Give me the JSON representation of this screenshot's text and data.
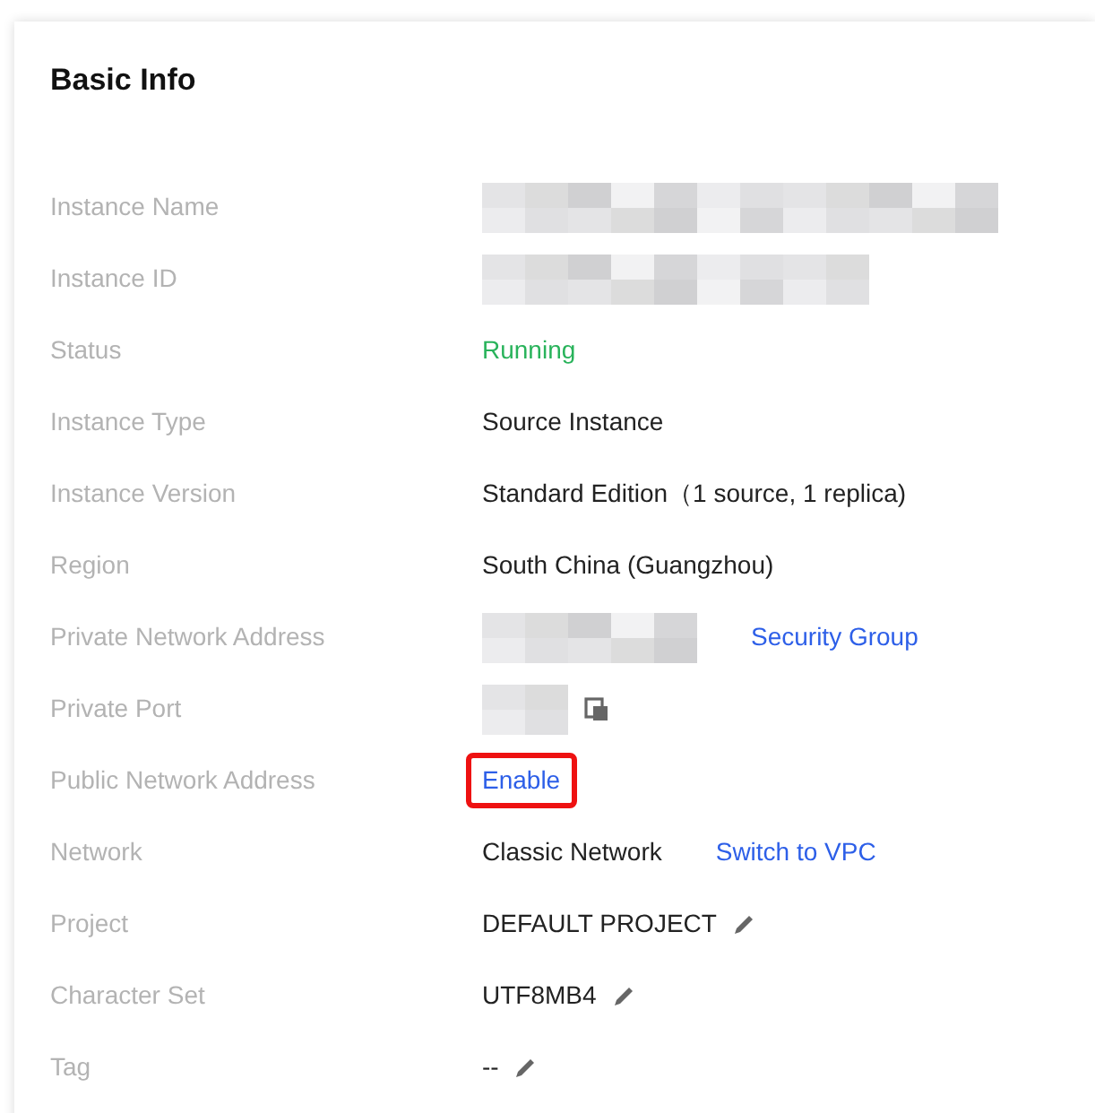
{
  "card": {
    "title": "Basic Info",
    "rows": [
      {
        "label": "Instance Name",
        "kind": "redacted"
      },
      {
        "label": "Instance ID",
        "kind": "redacted"
      },
      {
        "label": "Status",
        "kind": "status",
        "value": "Running"
      },
      {
        "label": "Instance Type",
        "kind": "text",
        "value": "Source Instance"
      },
      {
        "label": "Instance Version",
        "kind": "text",
        "value": "Standard Edition（1 source, 1 replica)"
      },
      {
        "label": "Region",
        "kind": "text",
        "value": "South China (Guangzhou)"
      },
      {
        "label": "Private Network Address",
        "kind": "redacted",
        "link": "Security Group"
      },
      {
        "label": "Private Port",
        "kind": "redacted",
        "copyable": true
      },
      {
        "label": "Public Network Address",
        "kind": "link",
        "value": "Enable",
        "highlighted": true
      },
      {
        "label": "Network",
        "kind": "text",
        "value": "Classic Network",
        "link": "Switch to VPC"
      },
      {
        "label": "Project",
        "kind": "text",
        "value": "DEFAULT PROJECT",
        "editable": true
      },
      {
        "label": "Character Set",
        "kind": "text",
        "value": "UTF8MB4",
        "editable": true
      },
      {
        "label": "Tag",
        "kind": "text",
        "value": "--",
        "editable": true
      }
    ]
  }
}
